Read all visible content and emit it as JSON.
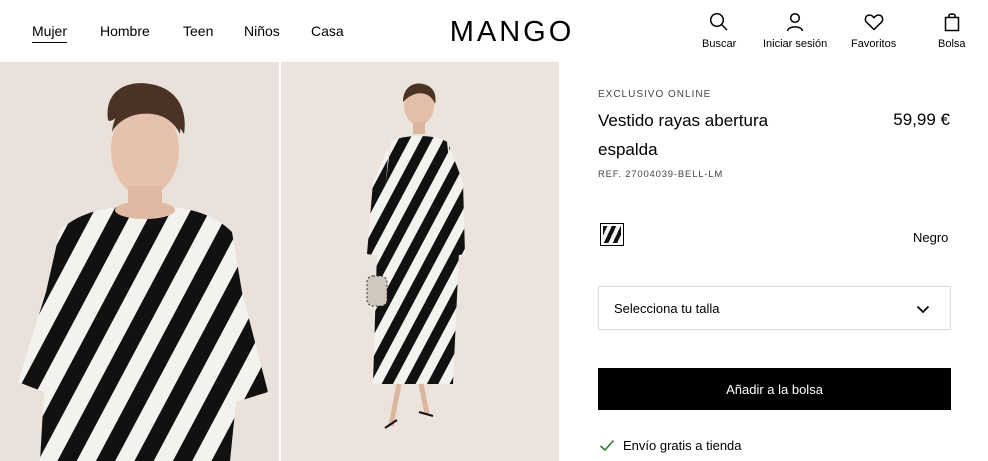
{
  "nav": {
    "items": [
      {
        "label": "Mujer",
        "active": true
      },
      {
        "label": "Hombre",
        "active": false
      },
      {
        "label": "Teen",
        "active": false
      },
      {
        "label": "Niños",
        "active": false
      },
      {
        "label": "Casa",
        "active": false
      }
    ]
  },
  "brand": {
    "logo": "MANGO"
  },
  "actions": {
    "search": {
      "label": "Buscar",
      "icon": "search-icon"
    },
    "account": {
      "label": "Iniciar sesión",
      "icon": "user-icon"
    },
    "favorites": {
      "label": "Favoritos",
      "icon": "heart-icon"
    },
    "bag": {
      "label": "Bolsa",
      "icon": "bag-icon"
    }
  },
  "product": {
    "badge": "EXCLUSIVO ONLINE",
    "title": "Vestido rayas abertura espalda",
    "price": "59,99 €",
    "ref": "REF. 27004039-BELL-LM",
    "color": "Negro",
    "size_placeholder": "Selecciona tu talla",
    "add_to_bag": "Añadir a la bolsa",
    "shipping": "Envío gratis a tienda"
  },
  "colors": {
    "accent": "#000000",
    "check": "#2e7d32",
    "image_bg": "#e9e1da"
  }
}
